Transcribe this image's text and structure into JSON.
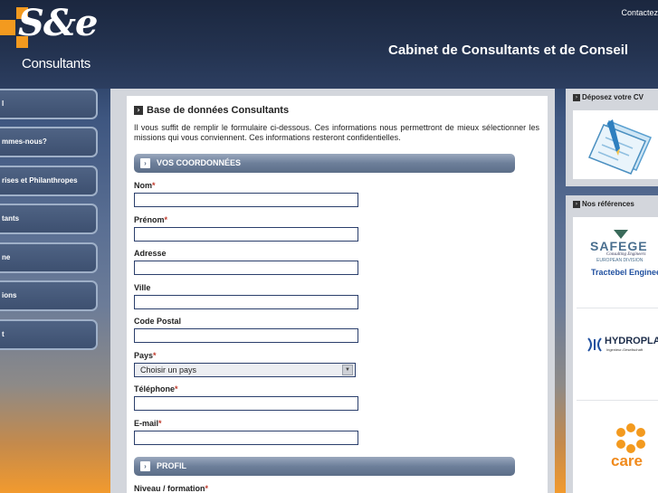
{
  "header": {
    "logo_main": "S&e",
    "logo_sub": "Consultants",
    "contact_link": "Contactez",
    "site_title": "Cabinet de Consultants et de Conseil"
  },
  "nav": {
    "items": [
      {
        "label": "l"
      },
      {
        "label": "mmes-nous?"
      },
      {
        "label": "rises et Philanthropes"
      },
      {
        "label": "tants"
      },
      {
        "label": "ne"
      },
      {
        "label": "ions"
      },
      {
        "label": "t"
      }
    ]
  },
  "main": {
    "title": "Base de données Consultants",
    "intro": "Il vous suffit de remplir le formulaire ci-dessous. Ces informations nous permettront de mieux sélectionner les missions qui vous conviennent. Ces informations resteront confidentielles.",
    "sections": {
      "coordonnees": "VOS COORDONNÉES",
      "profil": "PROFIL"
    },
    "fields": {
      "nom": "Nom",
      "prenom": "Prénom",
      "adresse": "Adresse",
      "ville": "Ville",
      "code_postal": "Code Postal",
      "pays": "Pays",
      "telephone": "Téléphone",
      "email": "E-mail",
      "niveau": "Niveau / formation"
    },
    "required_mark": "*",
    "country_select": {
      "selected": "Choisir un pays"
    }
  },
  "sidebar": {
    "cv_title": "Déposez votre CV",
    "refs_title": "Nos références",
    "refs": {
      "safege": "SAFEGE",
      "safege_sub1": "Consulting Engineers",
      "safege_sub2": "EUROPEAN DIVISION",
      "tractebel": "Tractebel Engineering",
      "hydroplan": "HYDROPLAN",
      "hydroplan_sub": "Ingenieur-Gesellschaft",
      "care": "care"
    }
  },
  "colors": {
    "accent_orange": "#f39a1f",
    "nav_bg": "#44587a",
    "section_bar": "#6d7f9a",
    "input_border": "#2b3f6c",
    "required": "#c0392b"
  }
}
